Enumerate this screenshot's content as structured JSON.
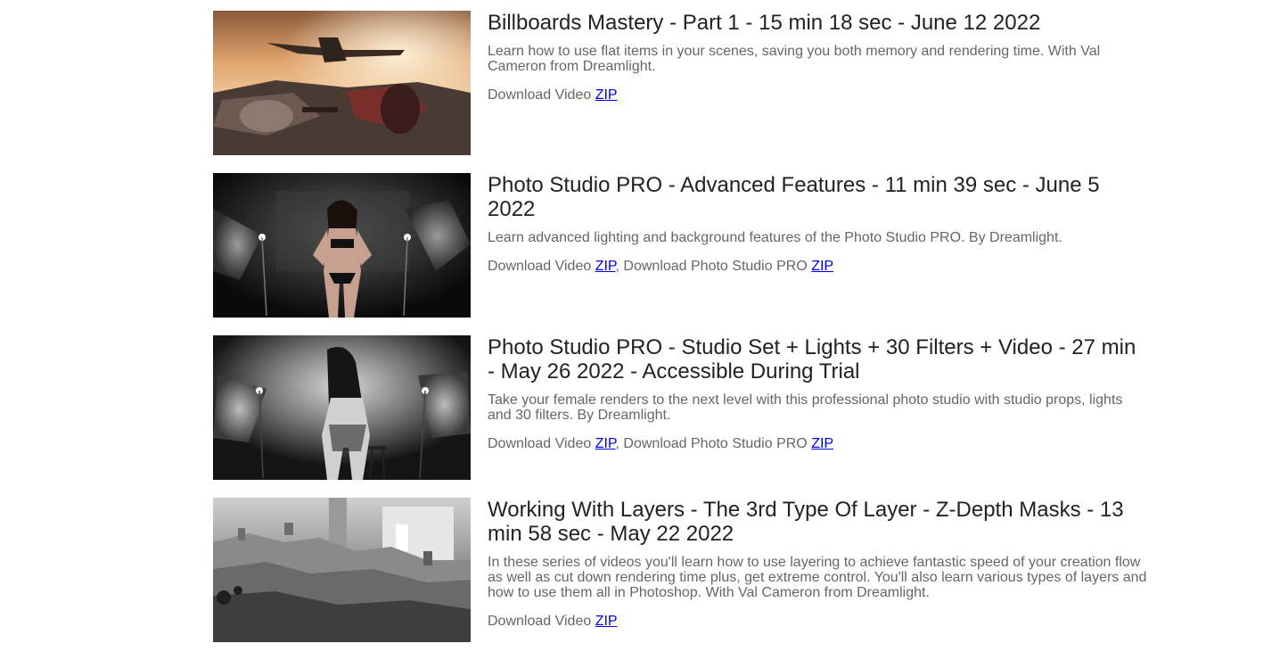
{
  "videos": [
    {
      "thumbnail_icon": "billboards-spaceship-thumbnail",
      "title": "Billboards Mastery - Part 1 - 15 min 18 sec - June 12 2022",
      "description": "Learn how to use flat items in your scenes, saving you both memory and rendering time. With Val Cameron from Dreamlight.",
      "downloads": [
        {
          "prefix": "Download Video ",
          "link": "ZIP"
        }
      ]
    },
    {
      "thumbnail_icon": "photo-studio-model-thumbnail",
      "title": "Photo Studio PRO - Advanced Features - 11 min 39 sec - June 5 2022",
      "description": "Learn advanced lighting and background features of the Photo Studio PRO. By Dreamlight.",
      "downloads": [
        {
          "prefix": "Download Video ",
          "link": "ZIP"
        },
        {
          "prefix": ", Download Photo Studio PRO ",
          "link": "ZIP"
        }
      ]
    },
    {
      "thumbnail_icon": "photo-studio-bw-thumbnail",
      "title": "Photo Studio PRO - Studio Set + Lights + 30 Filters + Video - 27 min - May 26 2022 - Accessible During Trial",
      "description": "Take your female renders to the next level with this professional photo studio with studio props, lights and 30 filters. By Dreamlight.",
      "downloads": [
        {
          "prefix": "Download Video ",
          "link": "ZIP"
        },
        {
          "prefix": ", Download Photo Studio PRO ",
          "link": "ZIP"
        }
      ]
    },
    {
      "thumbnail_icon": "zdepth-castle-thumbnail",
      "title": "Working With Layers - The 3rd Type Of Layer - Z-Depth Masks - 13 min 58 sec - May 22 2022",
      "description": "In these series of videos you'll learn how to use layering to achieve fantastic speed of your creation flow as well as cut down rendering time plus, get extreme control. You'll also learn various types of layers and how to use them all in Photoshop. With Val Cameron from Dreamlight.",
      "downloads": [
        {
          "prefix": "Download Video ",
          "link": "ZIP"
        }
      ]
    }
  ],
  "colors": {
    "title": "#222222",
    "text": "#666666",
    "link": "#0000ee",
    "background": "#ffffff"
  }
}
